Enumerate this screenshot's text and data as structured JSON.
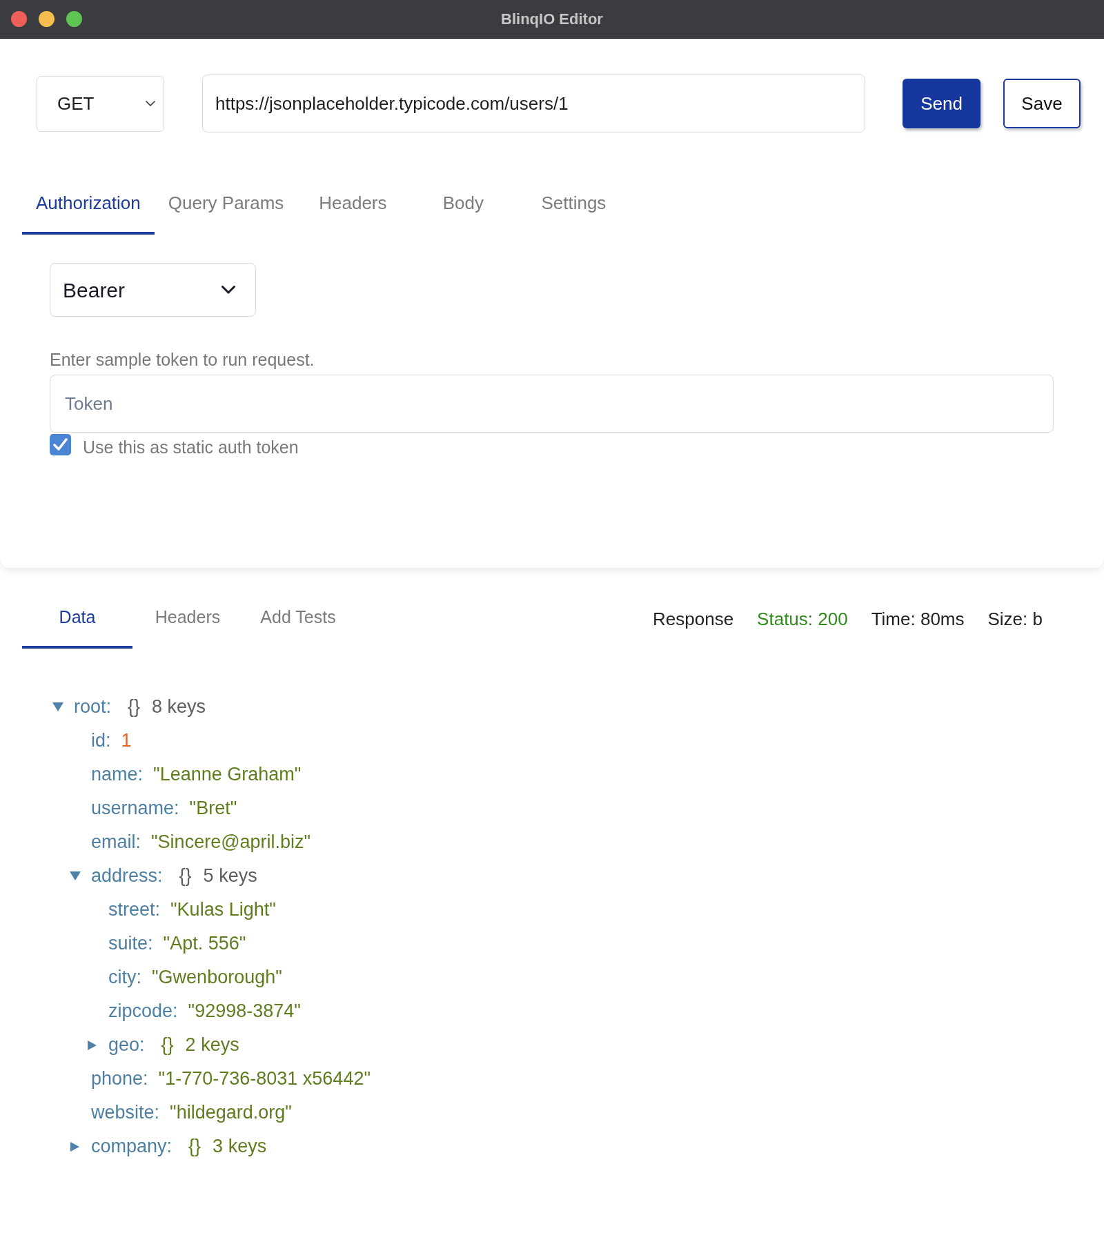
{
  "window": {
    "title": "BlinqIO Editor"
  },
  "request": {
    "method": "GET",
    "url": "https://jsonplaceholder.typicode.com/users/1",
    "buttons": [
      {
        "label": "Send",
        "kind": "primary"
      },
      {
        "label": "Save",
        "kind": "secondary"
      }
    ]
  },
  "request_tabs": [
    {
      "label": "Authorization",
      "selected": true
    },
    {
      "label": "Query Params",
      "selected": false
    },
    {
      "label": "Headers",
      "selected": false
    },
    {
      "label": "Body",
      "selected": false
    },
    {
      "label": "Settings",
      "selected": false
    }
  ],
  "authorization": {
    "type": "Bearer",
    "hint": "Enter sample token to run request.",
    "token_field": {
      "placeholder": "Token"
    },
    "static_token": {
      "label": "Use this as static auth token",
      "checked": true
    }
  },
  "response_tabs": [
    {
      "label": "Data",
      "selected": true
    },
    {
      "label": "Headers",
      "selected": false
    },
    {
      "label": "Add Tests",
      "selected": false
    }
  ],
  "response_info": [
    {
      "kind": "label",
      "text": "Response"
    },
    {
      "kind": "status",
      "text": "Status: 200"
    },
    {
      "kind": "metric",
      "text": "Time: 80ms"
    },
    {
      "kind": "metric",
      "text": "Size: b"
    }
  ],
  "tree": {
    "kind": "object",
    "key": "root:",
    "braces": "{}",
    "count": "8 keys",
    "expanded": true,
    "children": [
      {
        "kind": "number",
        "key": "id:",
        "value": "1"
      },
      {
        "kind": "string",
        "key": "name:",
        "value": "\"Leanne Graham\""
      },
      {
        "kind": "string",
        "key": "username:",
        "value": "\"Bret\""
      },
      {
        "kind": "string",
        "key": "email:",
        "value": "\"Sincere@april.biz\""
      },
      {
        "kind": "object",
        "key": "address:",
        "braces": "{}",
        "count": "5 keys",
        "expanded": true,
        "children": [
          {
            "kind": "string",
            "key": "street:",
            "value": "\"Kulas Light\""
          },
          {
            "kind": "string",
            "key": "suite:",
            "value": "\"Apt. 556\""
          },
          {
            "kind": "string",
            "key": "city:",
            "value": "\"Gwenborough\""
          },
          {
            "kind": "string",
            "key": "zipcode:",
            "value": "\"92998-3874\""
          },
          {
            "kind": "object",
            "key": "geo:",
            "braces": "{}",
            "count": "2 keys",
            "expanded": false
          }
        ]
      },
      {
        "kind": "string",
        "key": "phone:",
        "value": "\"1-770-736-8031 x56442\""
      },
      {
        "kind": "string",
        "key": "website:",
        "value": "\"hildegard.org\""
      },
      {
        "kind": "object",
        "key": "company:",
        "braces": "{}",
        "count": "3 keys",
        "expanded": false
      }
    ]
  }
}
